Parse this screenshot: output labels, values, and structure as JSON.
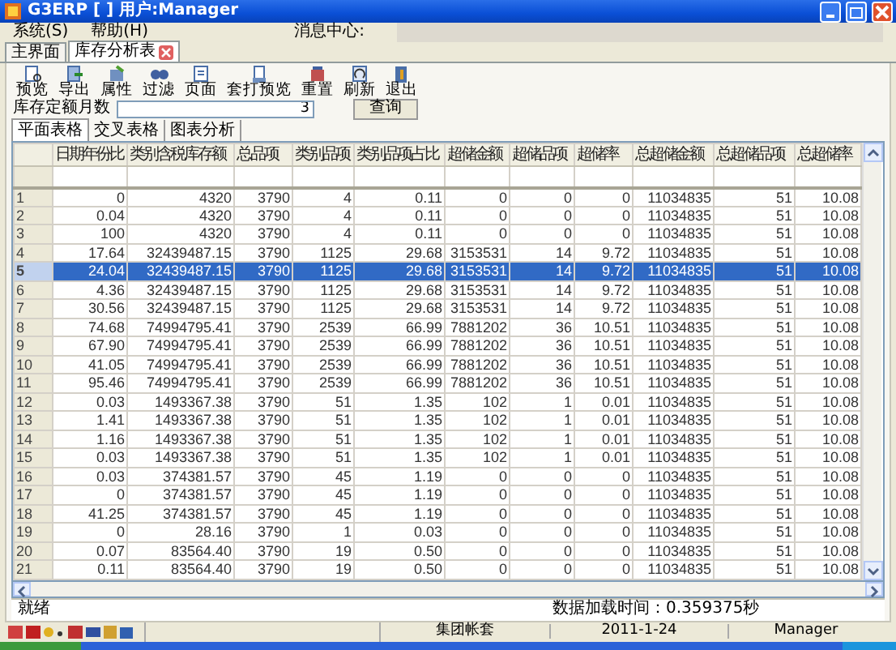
{
  "window": {
    "title": "G3ERP [ ] 用户:Manager"
  },
  "menu": [
    {
      "label": "系统(S)"
    },
    {
      "label": "帮助(H)"
    }
  ],
  "message_center": {
    "label": "消息中心:"
  },
  "tabs": [
    {
      "label": "主界面",
      "selected": false,
      "closable": false
    },
    {
      "label": "库存分析表",
      "selected": true,
      "closable": true
    }
  ],
  "toolbar": [
    "预览",
    "导出",
    "属性",
    "过滤",
    "页面",
    "套打预览",
    "重置",
    "刷新",
    "退出"
  ],
  "query": {
    "label": "库存定额月数",
    "value": "3",
    "button": "查询"
  },
  "view_tabs": [
    {
      "label": "平面表格",
      "selected": true
    },
    {
      "label": "交叉表格",
      "selected": false
    },
    {
      "label": "图表分析",
      "selected": false
    }
  ],
  "table": {
    "columns": [
      "日期年份比",
      "类别含税库存额",
      "总品项",
      "类别品项",
      "类别品项占比",
      "超储金额",
      "超储品项",
      "超储率",
      "总超储金额",
      "总超储品项",
      "总超储率"
    ],
    "rows": [
      {
        "number": "1",
        "selected": false,
        "cells": [
          "0",
          "4320",
          "3790",
          "4",
          "0.11",
          "0",
          "0",
          "0",
          "11034835",
          "51",
          "10.08"
        ]
      },
      {
        "number": "2",
        "selected": false,
        "cells": [
          "0.04",
          "4320",
          "3790",
          "4",
          "0.11",
          "0",
          "0",
          "0",
          "11034835",
          "51",
          "10.08"
        ]
      },
      {
        "number": "3",
        "selected": false,
        "cells": [
          "100",
          "4320",
          "3790",
          "4",
          "0.11",
          "0",
          "0",
          "0",
          "11034835",
          "51",
          "10.08"
        ]
      },
      {
        "number": "4",
        "selected": false,
        "cells": [
          "17.64",
          "32439487.15",
          "3790",
          "1125",
          "29.68",
          "3153531",
          "14",
          "9.72",
          "11034835",
          "51",
          "10.08"
        ]
      },
      {
        "number": "5",
        "selected": true,
        "cells": [
          "24.04",
          "32439487.15",
          "3790",
          "1125",
          "29.68",
          "3153531",
          "14",
          "9.72",
          "11034835",
          "51",
          "10.08"
        ]
      },
      {
        "number": "6",
        "selected": false,
        "cells": [
          "4.36",
          "32439487.15",
          "3790",
          "1125",
          "29.68",
          "3153531",
          "14",
          "9.72",
          "11034835",
          "51",
          "10.08"
        ]
      },
      {
        "number": "7",
        "selected": false,
        "cells": [
          "30.56",
          "32439487.15",
          "3790",
          "1125",
          "29.68",
          "3153531",
          "14",
          "9.72",
          "11034835",
          "51",
          "10.08"
        ]
      },
      {
        "number": "8",
        "selected": false,
        "cells": [
          "74.68",
          "74994795.41",
          "3790",
          "2539",
          "66.99",
          "7881202",
          "36",
          "10.51",
          "11034835",
          "51",
          "10.08"
        ]
      },
      {
        "number": "9",
        "selected": false,
        "cells": [
          "67.90",
          "74994795.41",
          "3790",
          "2539",
          "66.99",
          "7881202",
          "36",
          "10.51",
          "11034835",
          "51",
          "10.08"
        ]
      },
      {
        "number": "10",
        "selected": false,
        "cells": [
          "41.05",
          "74994795.41",
          "3790",
          "2539",
          "66.99",
          "7881202",
          "36",
          "10.51",
          "11034835",
          "51",
          "10.08"
        ]
      },
      {
        "number": "11",
        "selected": false,
        "cells": [
          "95.46",
          "74994795.41",
          "3790",
          "2539",
          "66.99",
          "7881202",
          "36",
          "10.51",
          "11034835",
          "51",
          "10.08"
        ]
      },
      {
        "number": "12",
        "selected": false,
        "cells": [
          "0.03",
          "1493367.38",
          "3790",
          "51",
          "1.35",
          "102",
          "1",
          "0.01",
          "11034835",
          "51",
          "10.08"
        ]
      },
      {
        "number": "13",
        "selected": false,
        "cells": [
          "1.41",
          "1493367.38",
          "3790",
          "51",
          "1.35",
          "102",
          "1",
          "0.01",
          "11034835",
          "51",
          "10.08"
        ]
      },
      {
        "number": "14",
        "selected": false,
        "cells": [
          "1.16",
          "1493367.38",
          "3790",
          "51",
          "1.35",
          "102",
          "1",
          "0.01",
          "11034835",
          "51",
          "10.08"
        ]
      },
      {
        "number": "15",
        "selected": false,
        "cells": [
          "0.03",
          "1493367.38",
          "3790",
          "51",
          "1.35",
          "102",
          "1",
          "0.01",
          "11034835",
          "51",
          "10.08"
        ]
      },
      {
        "number": "16",
        "selected": false,
        "cells": [
          "0.03",
          "374381.57",
          "3790",
          "45",
          "1.19",
          "0",
          "0",
          "0",
          "11034835",
          "51",
          "10.08"
        ]
      },
      {
        "number": "17",
        "selected": false,
        "cells": [
          "0",
          "374381.57",
          "3790",
          "45",
          "1.19",
          "0",
          "0",
          "0",
          "11034835",
          "51",
          "10.08"
        ]
      },
      {
        "number": "18",
        "selected": false,
        "cells": [
          "41.25",
          "374381.57",
          "3790",
          "45",
          "1.19",
          "0",
          "0",
          "0",
          "11034835",
          "51",
          "10.08"
        ]
      },
      {
        "number": "19",
        "selected": false,
        "cells": [
          "0",
          "28.16",
          "3790",
          "1",
          "0.03",
          "0",
          "0",
          "0",
          "11034835",
          "51",
          "10.08"
        ]
      },
      {
        "number": "20",
        "selected": false,
        "cells": [
          "0.07",
          "83564.40",
          "3790",
          "19",
          "0.50",
          "0",
          "0",
          "0",
          "11034835",
          "51",
          "10.08"
        ]
      },
      {
        "number": "21",
        "selected": false,
        "cells": [
          "0.11",
          "83564.40",
          "3790",
          "19",
          "0.50",
          "0",
          "0",
          "0",
          "11034835",
          "51",
          "10.08"
        ]
      }
    ]
  },
  "status": {
    "state": "就绪",
    "load_time": "数据加载时间：0.359375秒"
  },
  "bottom_bar": {
    "account": "集团帐套",
    "date": "2011-1-24",
    "user": "Manager"
  }
}
